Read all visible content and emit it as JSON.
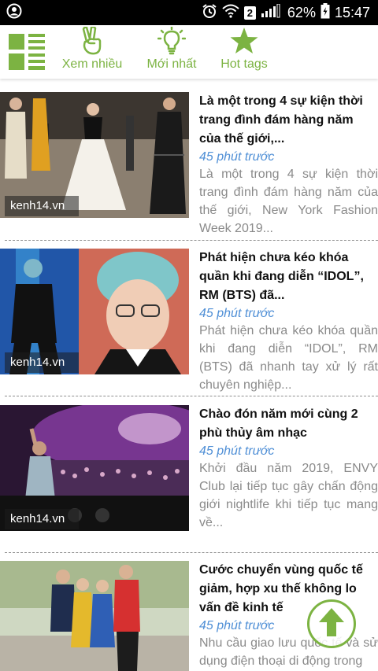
{
  "status_bar": {
    "sim_label": "2",
    "battery": "62%",
    "time": "15:47",
    "icons": [
      "account-circle-icon",
      "alarm-icon",
      "wifi-icon",
      "signal-icon",
      "battery-charging-icon"
    ]
  },
  "nav": {
    "menu_icon": "grid-menu-icon",
    "items": [
      {
        "label": "Xem nhiều",
        "icon": "peace-hand-icon"
      },
      {
        "label": "Mới nhất",
        "icon": "lightbulb-icon"
      },
      {
        "label": "Hot tags",
        "icon": "star-icon"
      }
    ],
    "accent_color": "#7cb342"
  },
  "articles": [
    {
      "source": "kenh14.vn",
      "title": "Là một trong 4 sự kiện thời trang đình đám hàng năm của thế giới,...",
      "time": "45 phút trước",
      "desc": "Là một trong 4 sự kiện thời trang đình đám hàng năm của thế giới, New York Fashion Week 2019..."
    },
    {
      "source": "kenh14.vn",
      "title": "Phát hiện chưa kéo khóa quần khi đang diễn “IDOL”, RM (BTS) đã...",
      "time": "45 phút trước",
      "desc": "Phát hiện chưa kéo khóa quần khi đang diễn “IDOL”, RM (BTS) đã nhanh tay xử lý rất chuyên nghiệp..."
    },
    {
      "source": "kenh14.vn",
      "title": "Chào đón năm mới cùng 2 phù thủy âm nhạc",
      "time": "45 phút trước",
      "desc": "Khởi đầu năm 2019, ENVY Club lại tiếp tục gây chấn động giới nightlife khi tiếp tục mang về..."
    },
    {
      "source": "",
      "title": "Cước chuyển vùng quốc tế giảm, hợp xu thế không lo vấn đề kinh tế",
      "time": "45 phút trước",
      "desc": "Nhu cầu giao lưu quốc tế và sử dụng điện thoại di động trong"
    }
  ],
  "fab_icon": "arrow-up-icon"
}
